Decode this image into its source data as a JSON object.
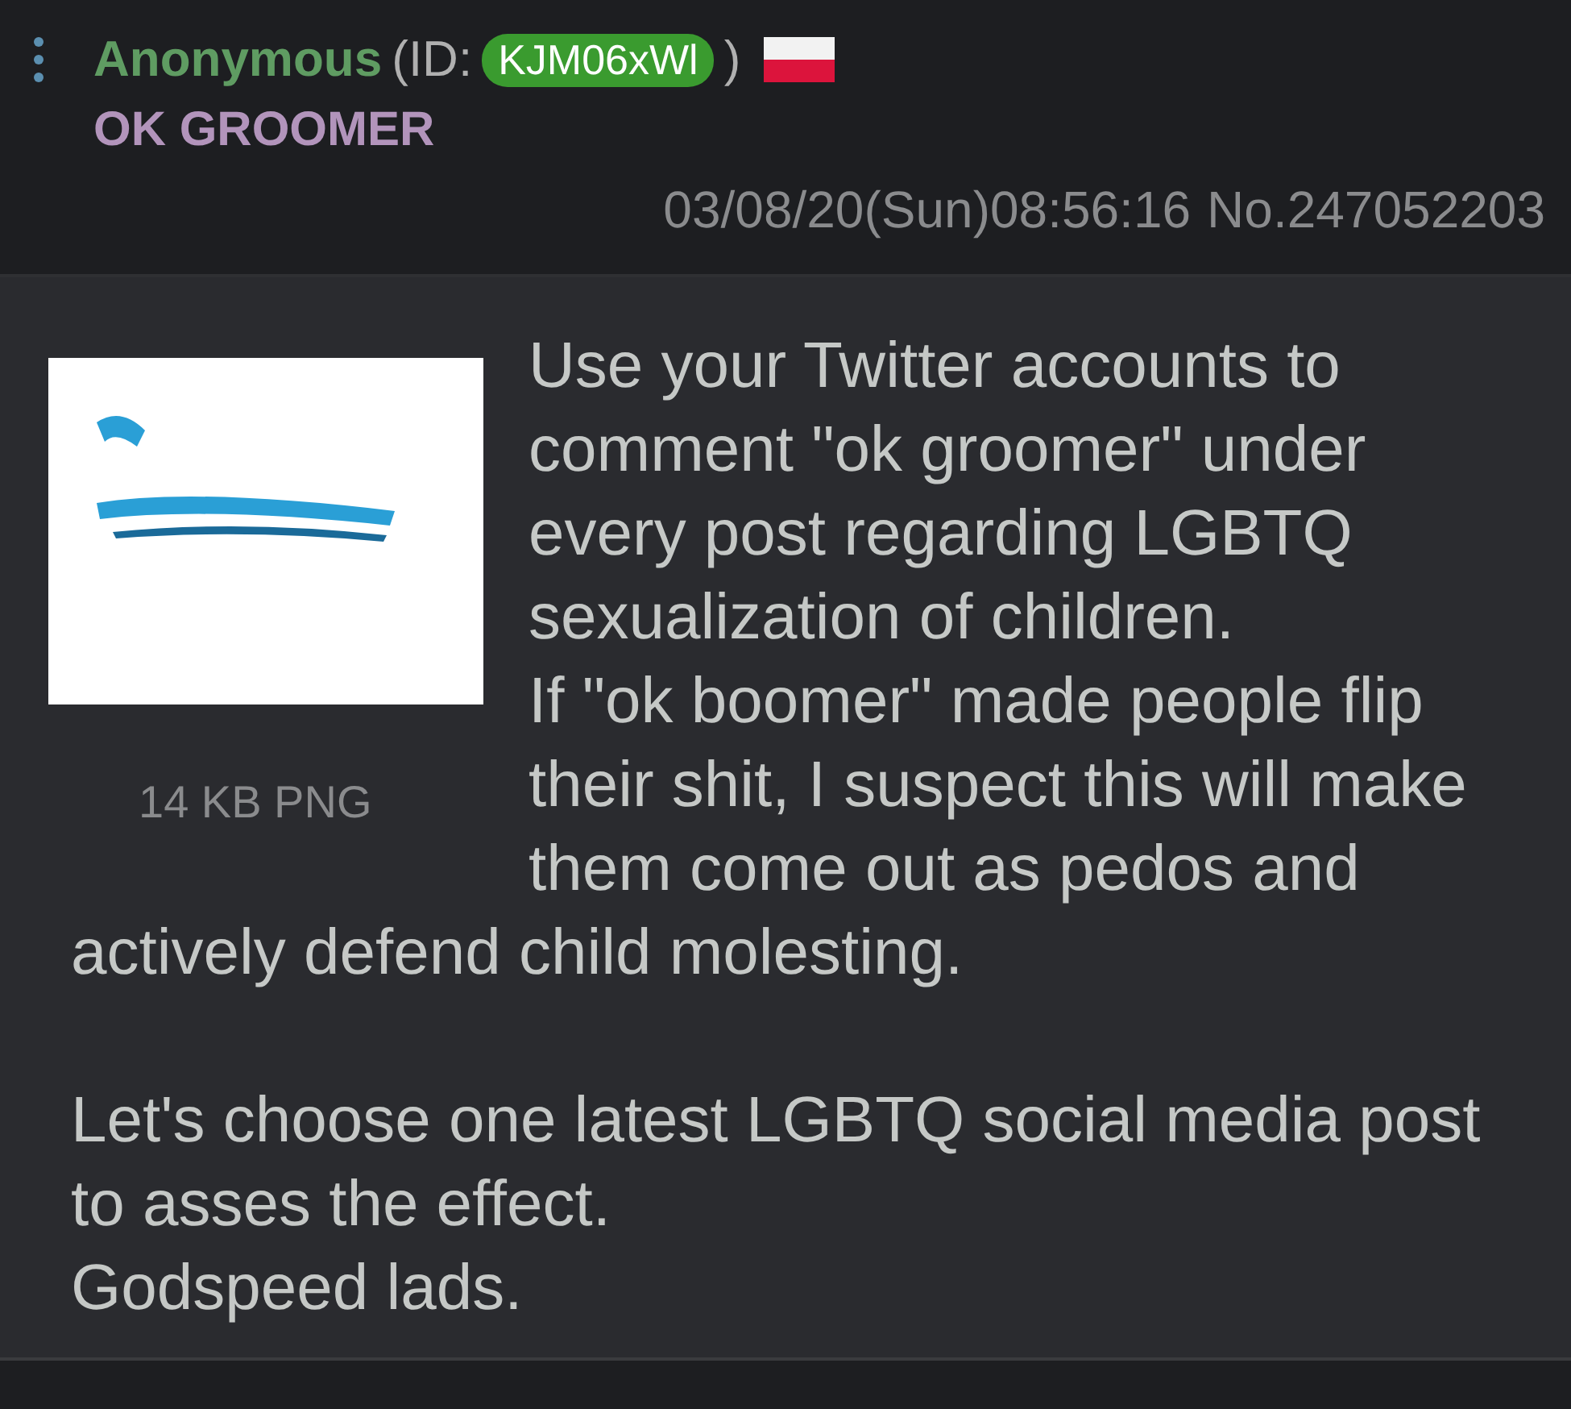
{
  "post": {
    "name": "Anonymous",
    "id_prefix": "(ID:",
    "id": "KJM06xWl",
    "id_suffix": ")",
    "flag": {
      "kind": "poland"
    },
    "subject": "OK GROOMER",
    "datetime": "03/08/20(Sun)08:56:16",
    "number": "No.247052203"
  },
  "attachment": {
    "kind": "picture",
    "info": "14 KB PNG"
  },
  "comment": [
    [
      "Use your Twitter accounts to",
      "comment \"ok groomer\" under",
      "every post regarding LGBTQ",
      "sexualization of children.",
      "If \"ok boomer\" made people flip",
      "their shit, I suspect this will make",
      "them come out as pedos and",
      "actively defend child molesting."
    ],
    [
      "Let's choose one latest LGBTQ social media post",
      "to asses the effect.",
      "Godspeed lads."
    ]
  ]
}
